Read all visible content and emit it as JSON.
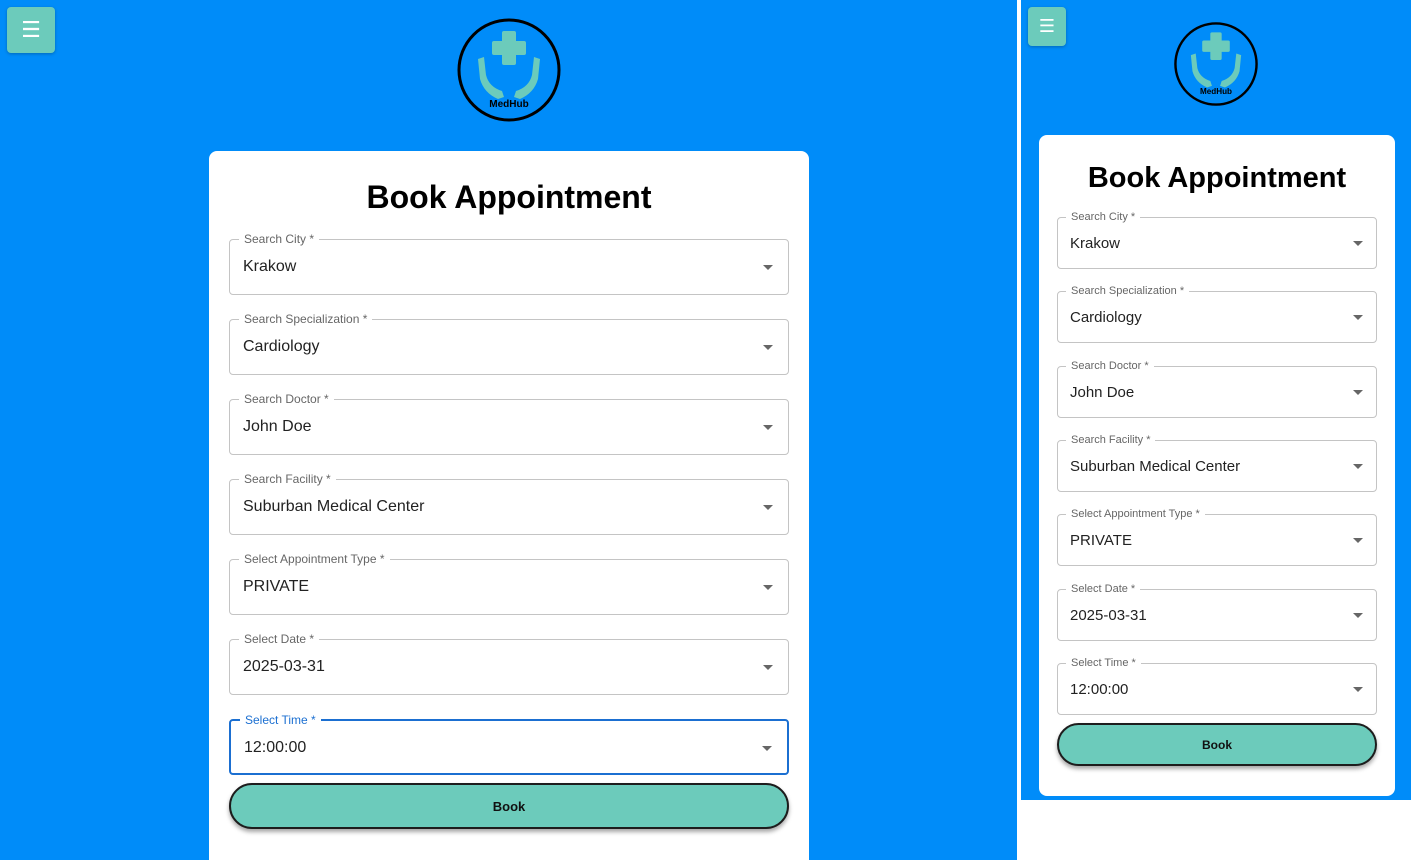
{
  "menu": {
    "icon": "hamburger-menu-icon",
    "glyph": "☰"
  },
  "logo": {
    "text": "MedHub",
    "icon": "medical-cross-hands-icon"
  },
  "form": {
    "title": "Book Appointment",
    "fields": [
      {
        "label": "Search City *",
        "value": "Krakow"
      },
      {
        "label": "Search Specialization *",
        "value": "Cardiology"
      },
      {
        "label": "Search Doctor *",
        "value": "John Doe"
      },
      {
        "label": "Search Facility *",
        "value": "Suburban Medical Center"
      },
      {
        "label": "Select Appointment Type *",
        "value": "PRIVATE"
      },
      {
        "label": "Select Date *",
        "value": "2025-03-31"
      },
      {
        "label": "Select Time *",
        "value": "12:00:00"
      }
    ],
    "submit_label": "Book"
  },
  "colors": {
    "background": "#008cf9",
    "accent": "#6ccbbb",
    "focus": "#1b6fd1",
    "logo_ring": "#000000"
  }
}
